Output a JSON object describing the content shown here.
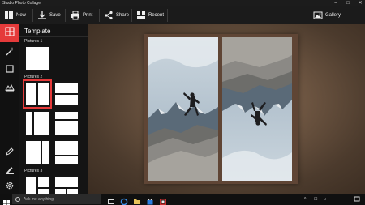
{
  "window": {
    "title": "Studio Photo Collage",
    "controls": [
      "–",
      "□",
      "✕"
    ]
  },
  "toolbar": {
    "new_label": "New",
    "save_label": "Save",
    "print_label": "Print",
    "share_label": "Share",
    "recent_label": "Recent",
    "gallery_label": "Gallery"
  },
  "rail": {
    "items": [
      {
        "name": "template",
        "icon": "grid-icon",
        "active": true
      },
      {
        "name": "effects",
        "icon": "magic-wand-icon",
        "active": false
      },
      {
        "name": "crop",
        "icon": "crop-icon",
        "active": false
      },
      {
        "name": "background",
        "icon": "landscape-icon",
        "active": false
      },
      {
        "name": "draw",
        "icon": "pencil-icon",
        "active": false
      },
      {
        "name": "text",
        "icon": "pen-icon",
        "active": false
      },
      {
        "name": "settings",
        "icon": "gear-icon",
        "active": false
      }
    ]
  },
  "panel": {
    "title": "Template",
    "sections": [
      {
        "label": "Pictures 1"
      },
      {
        "label": "Pictures 2"
      },
      {
        "label": "Pictures 3"
      }
    ]
  },
  "taskbar": {
    "search_placeholder": "Ask me anything",
    "tray_time": "",
    "tray_icons": [
      "^",
      "☐",
      "♪"
    ]
  },
  "colors": {
    "accent": "#e53a3a",
    "canvas_bg": "#6e5642",
    "frame_bg": "#5f4535"
  }
}
